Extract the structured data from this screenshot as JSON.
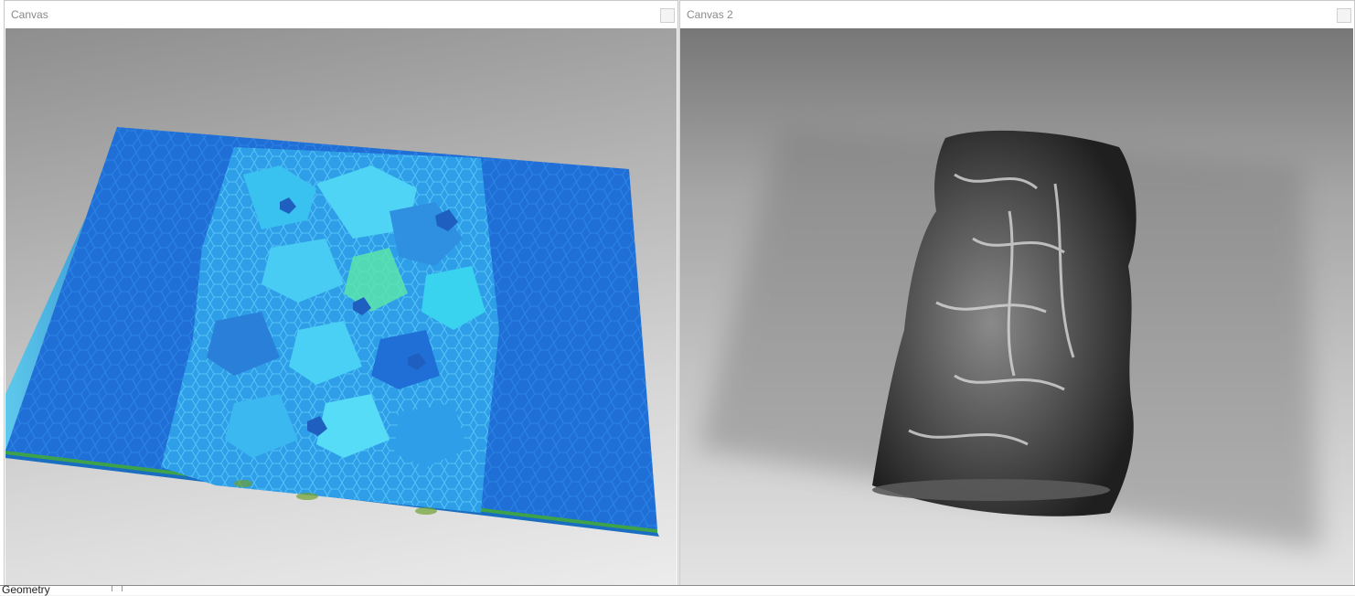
{
  "windows": [
    {
      "title": "Canvas",
      "close_icon": "close-icon"
    },
    {
      "title": "Canvas 2",
      "close_icon": "close-icon"
    }
  ],
  "status": {
    "label": "Geometry"
  },
  "colors": {
    "slab_dark": "#1f6fd6",
    "slab_light": "#3bb8f0",
    "cell_cyan": "#39d3f0",
    "cell_green": "#5ce8a8",
    "mesh_dark": "#2e2e2e",
    "mesh_highlight": "#d8d8d8"
  }
}
